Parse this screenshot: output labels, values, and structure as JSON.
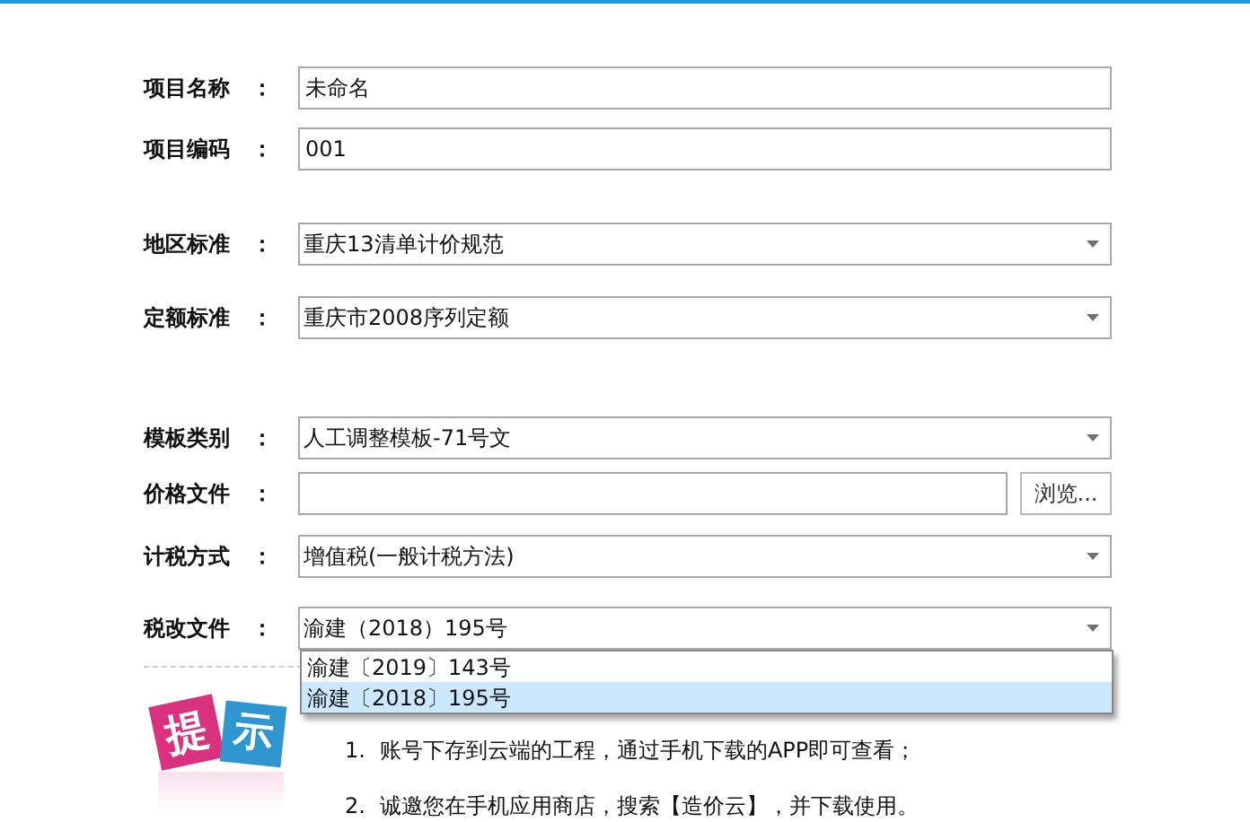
{
  "fields": [
    {
      "label": "项目名称",
      "colon": "：",
      "kind": "text",
      "value": "未命名"
    },
    {
      "label": "项目编码",
      "colon": "：",
      "kind": "text",
      "value": "001"
    },
    {
      "label": "地区标准",
      "colon": "：",
      "kind": "select",
      "value": "重庆13清单计价规范"
    },
    {
      "label": "定额标准",
      "colon": "：",
      "kind": "select",
      "value": "重庆市2008序列定额"
    },
    {
      "label": "模板类别",
      "colon": "：",
      "kind": "select",
      "value": "人工调整模板-71号文"
    },
    {
      "label": "价格文件",
      "colon": "：",
      "kind": "file",
      "button": "浏览..."
    },
    {
      "label": "计税方式",
      "colon": "：",
      "kind": "select",
      "value": "增值税(一般计税方法)"
    },
    {
      "label": "税改文件",
      "colon": "：",
      "kind": "select",
      "value": "渝建（2018）195号"
    }
  ],
  "dropdown_list": {
    "options": [
      {
        "label": "渝建〔2019〕143号",
        "selected": false
      },
      {
        "label": "渝建〔2018〕195号",
        "selected": true
      }
    ]
  },
  "tip_badge": [
    "提",
    "示"
  ],
  "notes": [
    {
      "number": "1.",
      "text": "账号下存到云端的工程，通过手机下载的APP即可查看；"
    },
    {
      "number": "2.",
      "text": "诚邀您在手机应用商店，搜索【造价云】，并下载使用。"
    }
  ]
}
